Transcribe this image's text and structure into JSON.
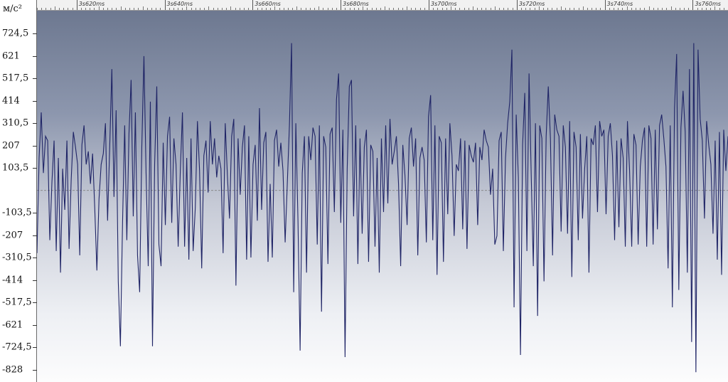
{
  "y_axis": {
    "unit": "м/с²",
    "labels": [
      "724,5",
      "621",
      "517,5",
      "414",
      "310,5",
      "207",
      "103,5",
      "-103,5",
      "-207",
      "-310,5",
      "-414",
      "-517,5",
      "-621",
      "-724,5",
      "-828"
    ]
  },
  "time_ruler": {
    "labels": [
      "3s620ms",
      "3s640ms",
      "3s660ms",
      "3s680ms",
      "3s700ms",
      "3s720ms",
      "3s740ms",
      "3s760ms"
    ]
  },
  "colors": {
    "waveform": "#1f2466",
    "zero_line": "#8a8a8a"
  },
  "chart_data": {
    "type": "line",
    "xlabel": "",
    "ylabel": "м/с²",
    "xlim_ms": [
      3611,
      3768
    ],
    "ylim": [
      -885,
      830
    ],
    "series": [
      {
        "values": [
          -290,
          150,
          360,
          80,
          250,
          230,
          -230,
          40,
          230,
          -280,
          150,
          -380,
          100,
          -90,
          230,
          -270,
          50,
          270,
          200,
          120,
          -300,
          210,
          300,
          120,
          180,
          30,
          170,
          -80,
          -370,
          -40,
          120,
          170,
          310,
          -140,
          200,
          560,
          -30,
          370,
          -420,
          -720,
          -150,
          300,
          -230,
          260,
          510,
          -120,
          360,
          -300,
          -470,
          200,
          620,
          80,
          -350,
          410,
          -720,
          120,
          480,
          -250,
          -350,
          220,
          -160,
          250,
          340,
          -150,
          240,
          120,
          -260,
          90,
          360,
          -260,
          150,
          -320,
          240,
          -280,
          -80,
          320,
          90,
          -360,
          160,
          230,
          -10,
          320,
          120,
          240,
          60,
          160,
          100,
          -290,
          310,
          70,
          -130,
          250,
          330,
          -440,
          240,
          -20,
          200,
          300,
          -320,
          250,
          -310,
          120,
          210,
          -140,
          380,
          -90,
          220,
          270,
          -330,
          30,
          -310,
          230,
          280,
          110,
          220,
          90,
          -240,
          30,
          300,
          680,
          -470,
          310,
          -140,
          -740,
          80,
          250,
          -380,
          250,
          140,
          290,
          250,
          -250,
          300,
          -560,
          250,
          200,
          -340,
          260,
          290,
          -100,
          420,
          540,
          -150,
          280,
          -770,
          100,
          480,
          510,
          -120,
          300,
          -340,
          240,
          -200,
          200,
          280,
          -330,
          210,
          180,
          -260,
          150,
          -380,
          240,
          -100,
          300,
          -60,
          330,
          120,
          180,
          250,
          30,
          -350,
          210,
          70,
          -160,
          240,
          290,
          110,
          240,
          -300,
          150,
          200,
          140,
          -240,
          340,
          440,
          -230,
          300,
          -390,
          250,
          220,
          -330,
          240,
          -110,
          310,
          160,
          -210,
          120,
          90,
          240,
          -180,
          230,
          -270,
          210,
          160,
          130,
          220,
          -160,
          200,
          140,
          280,
          230,
          200,
          -20,
          100,
          -250,
          -210,
          230,
          270,
          -280,
          150,
          310,
          410,
          650,
          -540,
          350,
          60,
          -760,
          210,
          450,
          -280,
          540,
          80,
          -350,
          310,
          -580,
          300,
          240,
          -420,
          250,
          480,
          240,
          -300,
          350,
          280,
          250,
          -190,
          300,
          200,
          -200,
          320,
          -400,
          270,
          200,
          -230,
          260,
          -130,
          100,
          250,
          -380,
          240,
          210,
          300,
          -100,
          320,
          250,
          280,
          -110,
          250,
          310,
          160,
          -230,
          230,
          -170,
          240,
          150,
          -260,
          320,
          90,
          -260,
          260,
          210,
          -250,
          110,
          230,
          290,
          -260,
          300,
          240,
          -250,
          280,
          -180,
          300,
          350,
          240,
          110,
          -360,
          300,
          -540,
          380,
          630,
          -460,
          290,
          460,
          270,
          -380,
          560,
          -700,
          680,
          -840,
          650,
          330,
          230,
          -130,
          320,
          210,
          120,
          -200,
          230,
          -320,
          270,
          -390,
          280,
          90,
          250
        ]
      }
    ]
  }
}
